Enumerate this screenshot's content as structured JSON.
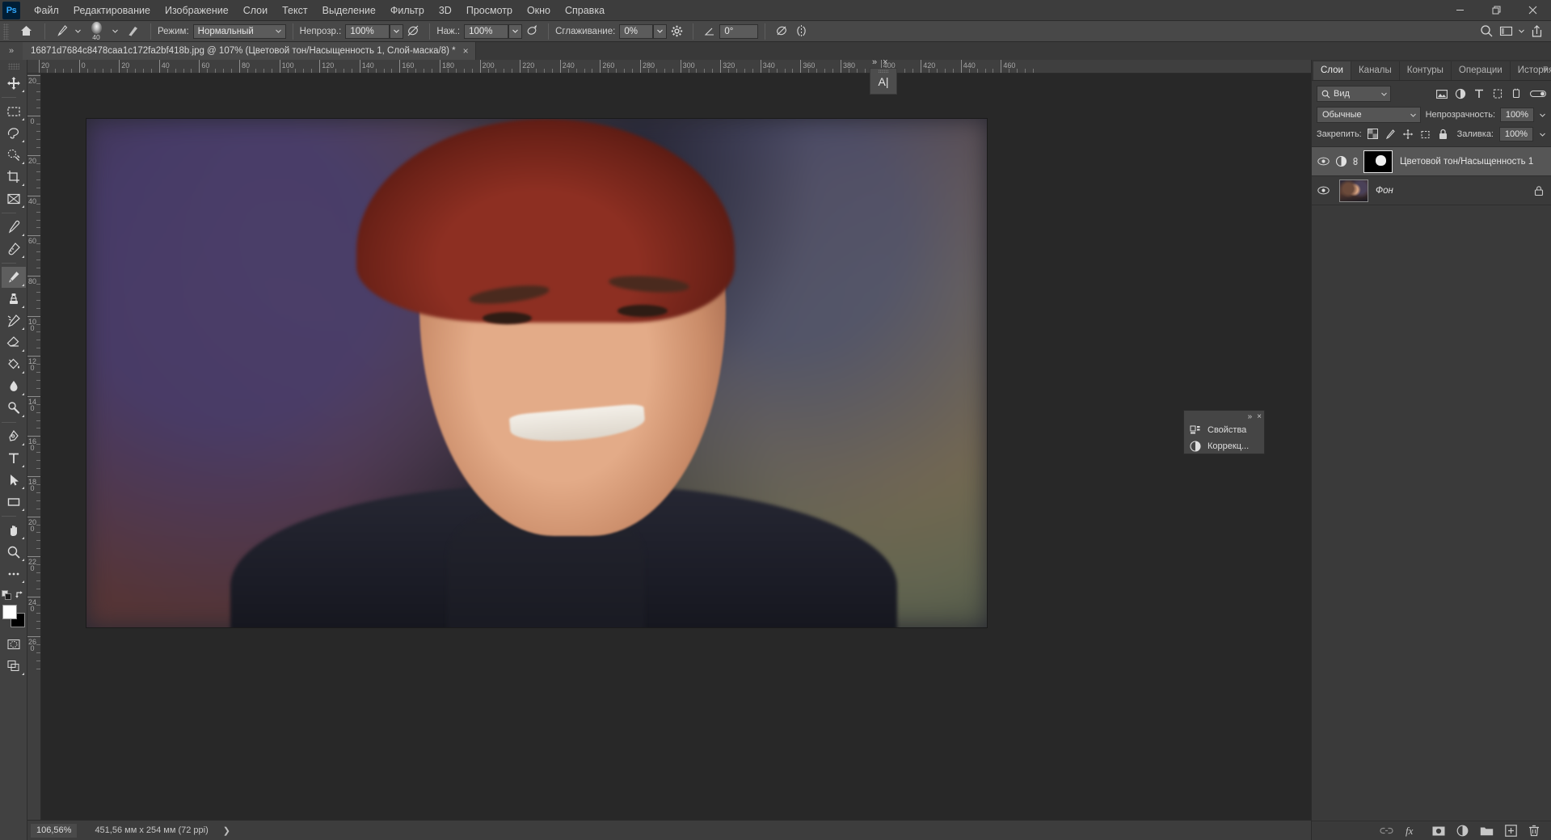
{
  "app": {
    "logo": "Ps",
    "menus": [
      "Файл",
      "Редактирование",
      "Изображение",
      "Слои",
      "Текст",
      "Выделение",
      "Фильтр",
      "3D",
      "Просмотр",
      "Окно",
      "Справка"
    ],
    "window_controls": [
      "minimize-button",
      "restore-button",
      "close-button"
    ]
  },
  "options_bar": {
    "home_icon": "home-icon",
    "brush_preset": "brush-preset-picker",
    "brush_size_label": "40",
    "brush_panel_icon": "brush-panel-icon",
    "mode_label": "Режим:",
    "mode_value": "Нормальный",
    "opacity_label": "Непрозр.:",
    "opacity_value": "100%",
    "opacity_pressure_icon": "pressure-opacity-icon",
    "flow_label": "Наж.:",
    "flow_value": "100%",
    "airbrush_icon": "airbrush-icon",
    "smoothing_label": "Сглаживание:",
    "smoothing_value": "0%",
    "smoothing_settings_icon": "gear-icon",
    "angle_icon": "angle-icon",
    "angle_value": "0°",
    "pressure_size_icon": "pressure-size-icon",
    "symmetry_icon": "symmetry-icon",
    "right_icons": [
      "search-icon",
      "workspace-icon",
      "chevron-down-icon",
      "share-icon"
    ]
  },
  "tabstrip": {
    "collapse_icon": "chevron-double-right-icon",
    "document_title": "16871d7684c8478caa1c172fa2bf418b.jpg @ 107% (Цветовой тон/Насыщенность 1, Слой-маска/8) *",
    "close_icon": "close-icon"
  },
  "toolbar": {
    "tools": [
      {
        "name": "move-tool",
        "icon": "move-icon",
        "active": false
      },
      {
        "name": "marquee-tool",
        "icon": "rectangular-marquee-icon",
        "active": false
      },
      {
        "name": "lasso-tool",
        "icon": "lasso-icon",
        "active": false
      },
      {
        "name": "quick-selection-tool",
        "icon": "quick-selection-icon",
        "active": false
      },
      {
        "name": "crop-tool",
        "icon": "crop-icon",
        "active": false
      },
      {
        "name": "frame-tool",
        "icon": "frame-icon",
        "active": false
      },
      {
        "name": "eyedropper-tool",
        "icon": "eyedropper-icon",
        "active": false
      },
      {
        "name": "healing-brush-tool",
        "icon": "healing-brush-icon",
        "active": false
      },
      {
        "name": "brush-tool",
        "icon": "brush-icon",
        "active": true
      },
      {
        "name": "clone-stamp-tool",
        "icon": "clone-stamp-icon",
        "active": false
      },
      {
        "name": "history-brush-tool",
        "icon": "history-brush-icon",
        "active": false
      },
      {
        "name": "eraser-tool",
        "icon": "eraser-icon",
        "active": false
      },
      {
        "name": "gradient-tool",
        "icon": "paint-bucket-icon",
        "active": false
      },
      {
        "name": "blur-tool",
        "icon": "blur-droplet-icon",
        "active": false
      },
      {
        "name": "dodge-tool",
        "icon": "dodge-icon",
        "active": false
      },
      {
        "name": "pen-tool",
        "icon": "pen-icon",
        "active": false
      },
      {
        "name": "type-tool",
        "icon": "type-T-icon",
        "active": false
      },
      {
        "name": "path-selection-tool",
        "icon": "path-arrow-icon",
        "active": false
      },
      {
        "name": "rectangle-tool",
        "icon": "rectangle-icon",
        "active": false
      },
      {
        "name": "hand-tool",
        "icon": "hand-icon",
        "active": false
      },
      {
        "name": "zoom-tool",
        "icon": "magnifier-icon",
        "active": false
      },
      {
        "name": "edit-toolbar-button",
        "icon": "ellipsis-icon",
        "active": false
      }
    ],
    "swap_colors_icon": "swap-colors-icon",
    "default_colors_icon": "default-colors-icon",
    "foreground_color": "#ffffff",
    "background_color": "#000000",
    "quick_mask_icon": "quick-mask-icon",
    "screen_mode_icon": "screen-mode-icon"
  },
  "rulers": {
    "h_labels": [
      "20",
      "0",
      "20",
      "40",
      "60",
      "80",
      "100",
      "120",
      "140",
      "160",
      "180",
      "200",
      "220",
      "240",
      "260",
      "280",
      "300",
      "320",
      "340",
      "360",
      "380",
      "400",
      "420",
      "440",
      "460"
    ],
    "v_labels": [
      "20",
      "0",
      "20",
      "40",
      "60",
      "80",
      "100",
      "120",
      "140",
      "160",
      "180",
      "200",
      "220",
      "240",
      "260"
    ]
  },
  "canvas_overlay": {
    "text_tag_value": "A",
    "collapse_icon": "chevron-double-right-icon",
    "close_icon": "close-icon"
  },
  "mini_panel": {
    "collapse_icon": "chevron-double-right-icon",
    "close_icon": "close-icon",
    "items": [
      {
        "label": "Свойства",
        "icon": "properties-icon"
      },
      {
        "label": "Коррекц...",
        "icon": "adjustments-icon"
      }
    ]
  },
  "layers_panel": {
    "tabs": [
      "Слои",
      "Каналы",
      "Контуры",
      "Операции",
      "История"
    ],
    "active_tab": "Слои",
    "filter": {
      "search_icon": "search-icon",
      "value": "Вид",
      "chevron_icon": "chevron-down-icon",
      "type_icons": [
        "image-filter-icon",
        "adjustment-filter-icon",
        "text-filter-icon",
        "shape-filter-icon",
        "smart-object-filter-icon"
      ],
      "toggle_icon": "filter-toggle-icon"
    },
    "blend_mode": "Обычные",
    "blend_chevron": "chevron-down-icon",
    "opacity_label": "Непрозрачность:",
    "opacity_value": "100%",
    "opacity_chevron": "chevron-down-icon",
    "lock_label": "Закрепить:",
    "lock_icons": [
      "lock-transparency-icon",
      "lock-pixels-icon",
      "lock-position-icon",
      "lock-artboard-icon",
      "lock-all-icon"
    ],
    "fill_label": "Заливка:",
    "fill_value": "100%",
    "fill_chevron": "chevron-down-icon",
    "layers": [
      {
        "name": "Цветовой тон/Насыщенность 1",
        "visible": true,
        "selected": true,
        "kind": "adjustment",
        "has_mask": true,
        "linked": true,
        "locked": false,
        "eye_icon": "eye-icon",
        "adjustment_icon": "hue-saturation-icon",
        "link_icon": "link-icon"
      },
      {
        "name": "Фон",
        "visible": true,
        "selected": false,
        "kind": "image",
        "has_mask": false,
        "linked": false,
        "locked": true,
        "eye_icon": "eye-icon",
        "lock_icon": "lock-icon"
      }
    ],
    "footer_icons": [
      "link-layers-icon",
      "layer-style-fx-icon",
      "add-mask-icon",
      "new-adjustment-icon",
      "new-group-icon",
      "new-layer-icon",
      "delete-layer-icon"
    ]
  },
  "status_bar": {
    "zoom": "106,56%",
    "document_size": "451,56 мм x 254 мм (72 ppi)",
    "expand_icon": "chevron-right-icon"
  }
}
